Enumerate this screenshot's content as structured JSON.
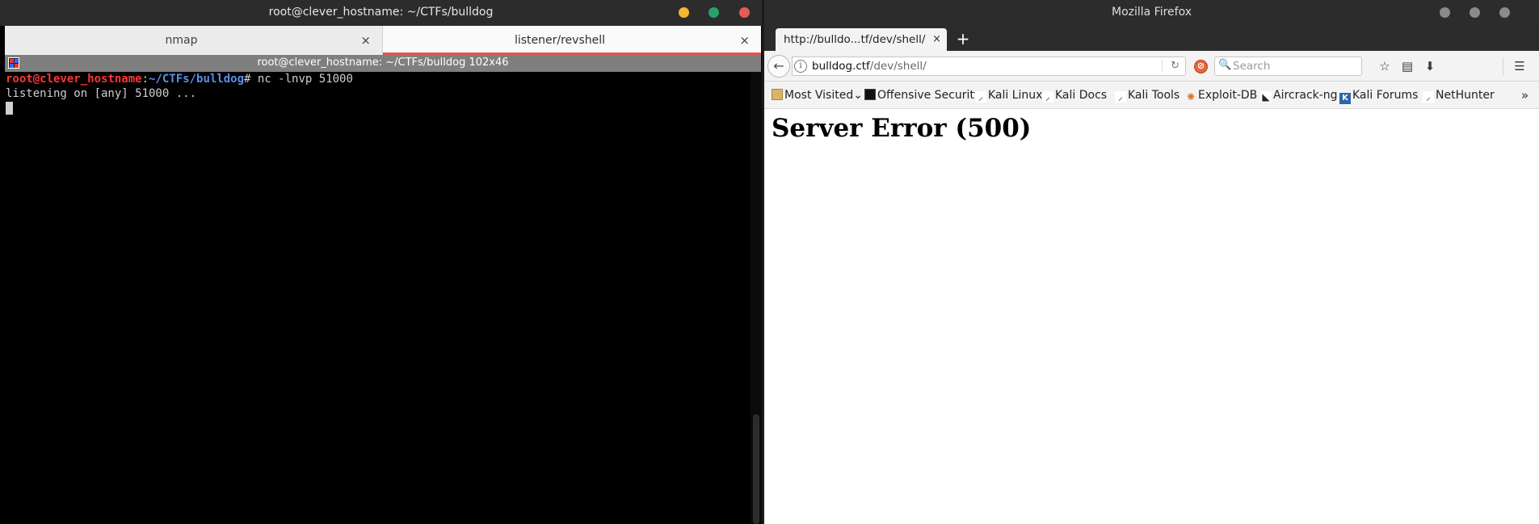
{
  "terminal": {
    "window_title": "root@clever_hostname: ~/CTFs/bulldog",
    "tabs": [
      {
        "label": "nmap",
        "close": "×",
        "active": false
      },
      {
        "label": "listener/revshell",
        "close": "×",
        "active": true
      }
    ],
    "subtitle": "root@clever_hostname: ~/CTFs/bulldog 102x46",
    "prompt_user": "root@clever_hostname",
    "prompt_colon": ":",
    "prompt_path": "~/CTFs/bulldog",
    "prompt_symbol": "#",
    "command": " nc -lnvp 51000",
    "output_line": "listening on [any] 51000 ...",
    "colors": {
      "user": "#ff3535",
      "path": "#5a8fe8",
      "active_tab_underline": "#e5554f"
    }
  },
  "firefox": {
    "window_title": "Mozilla Firefox",
    "tab": {
      "label": "http://bulldo...tf/dev/shell/",
      "close": "×"
    },
    "new_tab": "+",
    "back": "←",
    "url_host": "bulldog.ctf",
    "url_path": "/dev/shell/",
    "reload": "↻",
    "search_placeholder": "Search",
    "search_icon": "🔍",
    "toolbar": {
      "bookmark_star": "☆",
      "reading": "▤",
      "download": "⬇",
      "menu": "☰"
    },
    "bookmarks": [
      {
        "label": "Most Visited",
        "icon": "folder-icon",
        "arrow": "⌄"
      },
      {
        "label": "Offensive Security",
        "icon": "offsec-icon"
      },
      {
        "label": "Kali Linux",
        "icon": "kali-dragon-icon"
      },
      {
        "label": "Kali Docs",
        "icon": "kali-dragon-icon"
      },
      {
        "label": "Kali Tools",
        "icon": "kali-dragon-icon"
      },
      {
        "label": "Exploit-DB",
        "icon": "exploitdb-icon"
      },
      {
        "label": "Aircrack-ng",
        "icon": "aircrack-icon"
      },
      {
        "label": "Kali Forums",
        "icon": "kali-forums-icon"
      },
      {
        "label": "NetHunter",
        "icon": "kali-dragon-icon"
      }
    ],
    "bookmarks_overflow": "»",
    "page_heading": "Server Error (500)"
  }
}
